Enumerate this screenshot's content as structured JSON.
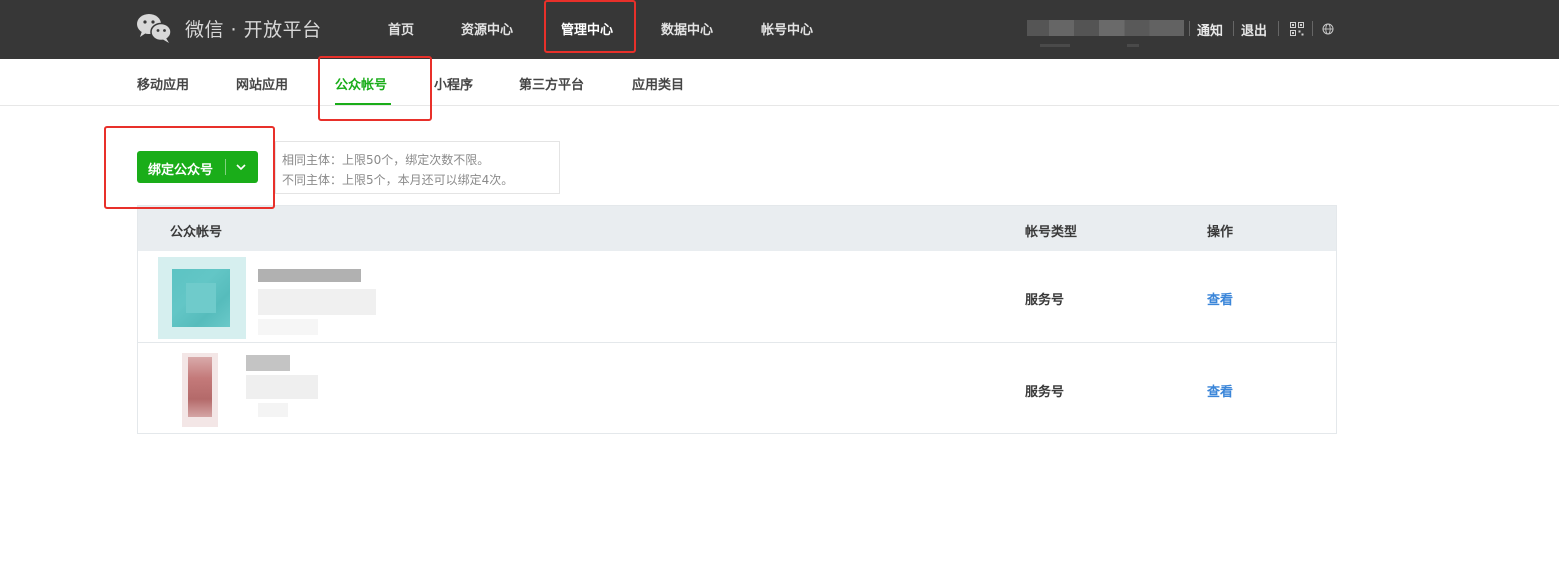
{
  "header": {
    "logo_text": "微信 · 开放平台",
    "nav": [
      {
        "label": "首页"
      },
      {
        "label": "资源中心"
      },
      {
        "label": "管理中心",
        "active": true
      },
      {
        "label": "数据中心"
      },
      {
        "label": "帐号中心"
      }
    ],
    "links": {
      "notify": "通知",
      "logout": "退出"
    },
    "icons": [
      "wechat-logo-icon",
      "qrcode-icon",
      "globe-icon"
    ]
  },
  "subnav": {
    "items": [
      {
        "label": "移动应用"
      },
      {
        "label": "网站应用"
      },
      {
        "label": "公众帐号",
        "active": true
      },
      {
        "label": "小程序"
      },
      {
        "label": "第三方平台"
      },
      {
        "label": "应用类目"
      }
    ]
  },
  "actions": {
    "bind_label": "绑定公众号",
    "info_line1": "相同主体：上限50个，绑定次数不限。",
    "info_line2": "不同主体：上限5个，本月还可以绑定4次。"
  },
  "table": {
    "headers": {
      "account": "公众帐号",
      "type": "帐号类型",
      "action": "操作"
    },
    "rows": [
      {
        "type": "服务号",
        "action": "查看"
      },
      {
        "type": "服务号",
        "action": "查看"
      }
    ]
  },
  "colors": {
    "topbar": "#373737",
    "accent_green": "#1aad19",
    "link_blue": "#3b86d9",
    "highlight_red": "#e8302a"
  }
}
